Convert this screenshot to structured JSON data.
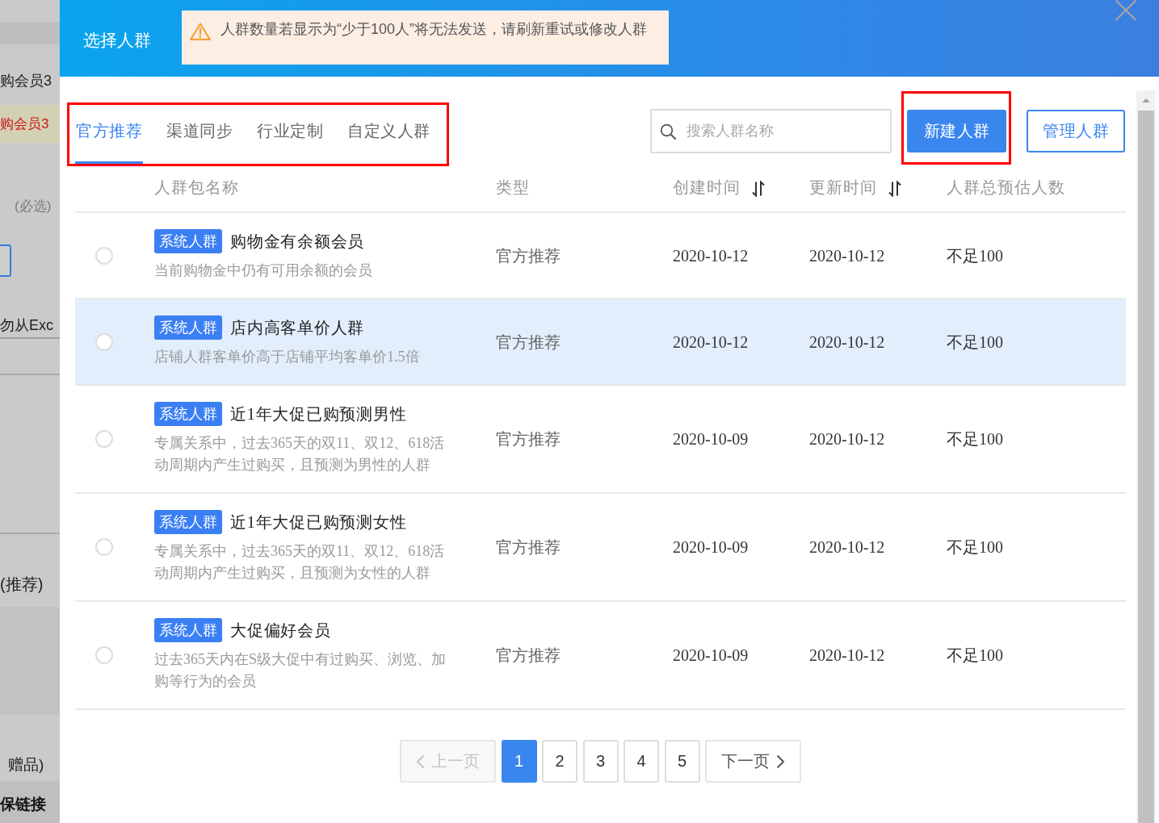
{
  "background_page": [
    {
      "kind": "text",
      "text": "购会员3"
    },
    {
      "kind": "alert",
      "text": "购会员3"
    },
    {
      "kind": "hint",
      "text": "(必选)"
    },
    {
      "kind": "field"
    },
    {
      "kind": "underlined",
      "text": "勿从Exc"
    },
    {
      "kind": "text",
      "text": "(推荐)"
    },
    {
      "kind": "text",
      "text": "赠品)"
    },
    {
      "kind": "bar",
      "text": "保链接"
    }
  ],
  "dialog": {
    "title": "选择人群",
    "notice": {
      "text": "人群数量若显示为“少于100人”将无法发送，请刷新重试或修改人群"
    },
    "tabs": {
      "highlighted": true,
      "items": [
        {
          "label": "官方推荐",
          "selected": true
        },
        {
          "label": "渠道同步",
          "selected": false
        },
        {
          "label": "行业定制",
          "selected": false
        },
        {
          "label": "自定义人群",
          "selected": false
        }
      ]
    },
    "search": {
      "placeholder": "搜索人群名称"
    },
    "buttons": [
      {
        "label": "新建人群",
        "kind": "primary",
        "highlighted": true
      },
      {
        "label": "管理人群",
        "kind": "outline",
        "highlighted": false
      }
    ],
    "table": {
      "columns": [
        {
          "label": "人群包名称",
          "sortable": false
        },
        {
          "label": "类型",
          "sortable": false
        },
        {
          "label": "创建时间",
          "sortable": true
        },
        {
          "label": "更新时间",
          "sortable": true
        },
        {
          "label": "人群总预估人数",
          "sortable": false
        }
      ],
      "rows": [
        {
          "selected": false,
          "highlighted": false,
          "tag": "系统人群",
          "name": "购物金有余额会员",
          "description": "当前购物金中仍有可用余额的会员",
          "type": "官方推荐",
          "created": "2020-10-12",
          "updated": "2020-10-12",
          "estimate": "不足100"
        },
        {
          "selected": false,
          "highlighted": true,
          "tag": "系统人群",
          "name": "店内高客单价人群",
          "description": "店铺人群客单价高于店铺平均客单价1.5倍",
          "type": "官方推荐",
          "created": "2020-10-12",
          "updated": "2020-10-12",
          "estimate": "不足100"
        },
        {
          "selected": false,
          "highlighted": false,
          "tag": "系统人群",
          "name": "近1年大促已购预测男性",
          "description": "专属关系中，过去365天的双11、双12、618活动周期内产生过购买，且预测为男性的人群",
          "type": "官方推荐",
          "created": "2020-10-09",
          "updated": "2020-10-12",
          "estimate": "不足100"
        },
        {
          "selected": false,
          "highlighted": false,
          "tag": "系统人群",
          "name": "近1年大促已购预测女性",
          "description": "专属关系中，过去365天的双11、双12、618活动周期内产生过购买，且预测为女性的人群",
          "type": "官方推荐",
          "created": "2020-10-09",
          "updated": "2020-10-12",
          "estimate": "不足100"
        },
        {
          "selected": false,
          "highlighted": false,
          "tag": "系统人群",
          "name": "大促偏好会员",
          "description": "过去365天内在S级大促中有过购买、浏览、加购等行为的会员",
          "type": "官方推荐",
          "created": "2020-10-09",
          "updated": "2020-10-12",
          "estimate": "不足100"
        }
      ]
    },
    "pagination": {
      "previous": {
        "label": "上一页",
        "disabled": true
      },
      "pages": [
        {
          "label": "1",
          "selected": true
        },
        {
          "label": "2",
          "selected": false
        },
        {
          "label": "3",
          "selected": false
        },
        {
          "label": "4",
          "selected": false
        },
        {
          "label": "5",
          "selected": false
        }
      ],
      "next": {
        "label": "下一页",
        "disabled": false
      }
    }
  }
}
